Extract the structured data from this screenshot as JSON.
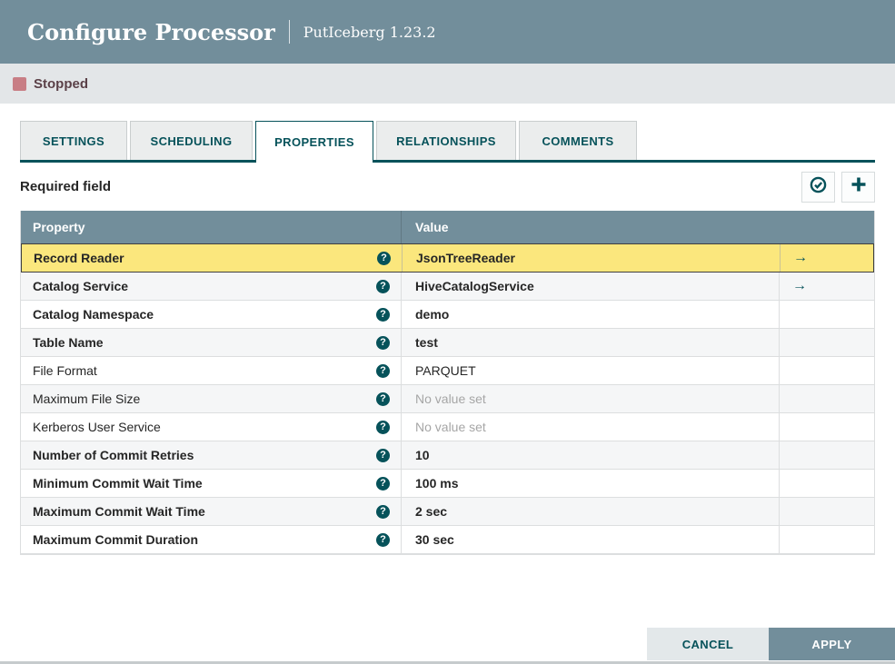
{
  "header": {
    "title": "Configure Processor",
    "subtitle": "PutIceberg 1.23.2"
  },
  "status": {
    "label": "Stopped",
    "color": "#C87E85"
  },
  "tabs": [
    {
      "label": "SETTINGS",
      "active": false
    },
    {
      "label": "SCHEDULING",
      "active": false
    },
    {
      "label": "PROPERTIES",
      "active": true
    },
    {
      "label": "RELATIONSHIPS",
      "active": false
    },
    {
      "label": "COMMENTS",
      "active": false
    }
  ],
  "toolbar": {
    "required_label": "Required field"
  },
  "icons": {
    "help_glyph": "?",
    "goto_glyph": "→"
  },
  "table": {
    "columns": [
      "Property",
      "Value"
    ],
    "rows": [
      {
        "property": "Record Reader",
        "value": "JsonTreeReader",
        "bold": true,
        "highlighted": true,
        "link": true,
        "unset": false
      },
      {
        "property": "Catalog Service",
        "value": "HiveCatalogService",
        "bold": true,
        "highlighted": false,
        "link": true,
        "unset": false
      },
      {
        "property": "Catalog Namespace",
        "value": "demo",
        "bold": true,
        "highlighted": false,
        "link": false,
        "unset": false
      },
      {
        "property": "Table Name",
        "value": "test",
        "bold": true,
        "highlighted": false,
        "link": false,
        "unset": false
      },
      {
        "property": "File Format",
        "value": "PARQUET",
        "bold": false,
        "highlighted": false,
        "link": false,
        "unset": false
      },
      {
        "property": "Maximum File Size",
        "value": "No value set",
        "bold": false,
        "highlighted": false,
        "link": false,
        "unset": true
      },
      {
        "property": "Kerberos User Service",
        "value": "No value set",
        "bold": false,
        "highlighted": false,
        "link": false,
        "unset": true
      },
      {
        "property": "Number of Commit Retries",
        "value": "10",
        "bold": true,
        "highlighted": false,
        "link": false,
        "unset": false
      },
      {
        "property": "Minimum Commit Wait Time",
        "value": "100 ms",
        "bold": true,
        "highlighted": false,
        "link": false,
        "unset": false
      },
      {
        "property": "Maximum Commit Wait Time",
        "value": "2 sec",
        "bold": true,
        "highlighted": false,
        "link": false,
        "unset": false
      },
      {
        "property": "Maximum Commit Duration",
        "value": "30 sec",
        "bold": true,
        "highlighted": false,
        "link": false,
        "unset": false
      }
    ]
  },
  "footer": {
    "cancel_label": "CANCEL",
    "apply_label": "APPLY"
  },
  "colors": {
    "header_bg": "#728E9B",
    "accent_teal": "#06525A",
    "highlight_yellow": "#FBE77D",
    "status_red": "#C87E85"
  }
}
